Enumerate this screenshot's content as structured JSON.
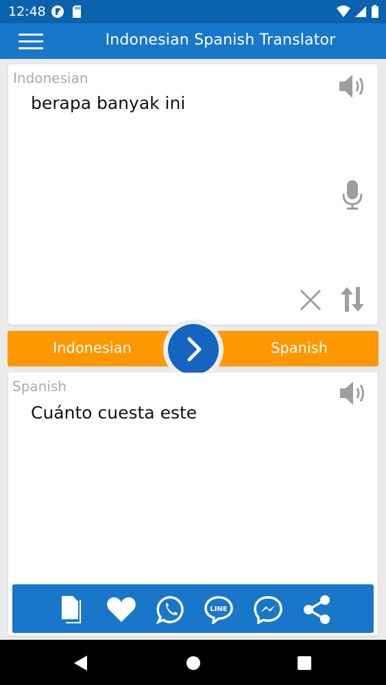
{
  "status_bar": {
    "time": "12:48",
    "icons": [
      "flipboard-icon",
      "sd-card-icon",
      "wifi-icon",
      "signal-icon",
      "battery-icon"
    ]
  },
  "app_bar": {
    "title": "Indonesian Spanish Translator",
    "menu_icon": "hamburger-menu-icon"
  },
  "source_panel": {
    "language": "Indonesian",
    "text": "berapa banyak ini",
    "icons": [
      "speaker-icon",
      "microphone-icon",
      "clear-icon",
      "swap-vertical-icon"
    ]
  },
  "language_bar": {
    "source_language": "Indonesian",
    "target_language": "Spanish",
    "translate_icon": "chevron-right-icon"
  },
  "target_panel": {
    "language": "Spanish",
    "text": "Cuánto cuesta este",
    "icons": [
      "speaker-icon"
    ]
  },
  "share_bar": {
    "icons": [
      "copy-icon",
      "favorite-heart-icon",
      "whatsapp-icon",
      "line-icon",
      "messenger-icon",
      "share-icon"
    ]
  },
  "nav_bar": {
    "icons": [
      "back-icon",
      "home-icon",
      "recents-icon"
    ]
  },
  "colors": {
    "status_bar": "#0b63ad",
    "app_bar": "#1877c9",
    "language_bar": "#ff9800",
    "translate_button": "#1565c0",
    "share_bar": "#1877c9",
    "icon_gray": "#9e9e9e"
  }
}
